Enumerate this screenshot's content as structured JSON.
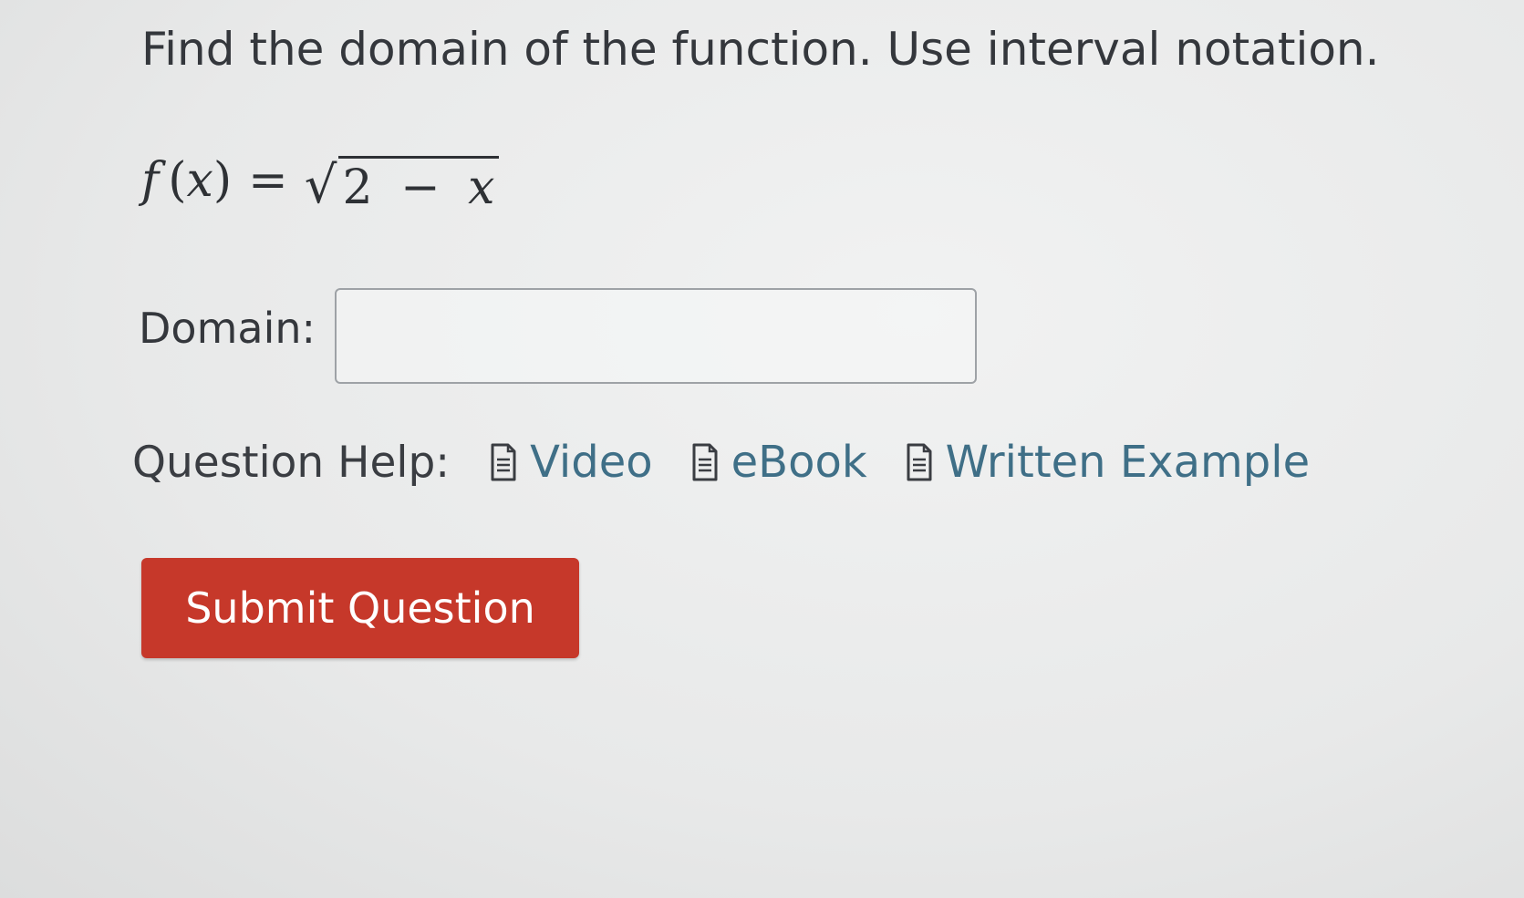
{
  "question": {
    "prompt": "Find the domain of the function. Use interval notation.",
    "formula": {
      "func": "f",
      "open_paren": "(",
      "var": "x",
      "close_paren": ")",
      "equals": "=",
      "root_sign": "√",
      "radicand_number": "2",
      "radicand_op": "−",
      "radicand_var": "x"
    }
  },
  "answer": {
    "label": "Domain:",
    "value": "",
    "placeholder": ""
  },
  "help": {
    "label": "Question Help:",
    "links": [
      {
        "label": "Video",
        "icon": "document-icon"
      },
      {
        "label": "eBook",
        "icon": "document-icon"
      },
      {
        "label": "Written Example",
        "icon": "document-icon"
      }
    ],
    "link_color": "#3f6f87"
  },
  "submit": {
    "label": "Submit Question",
    "color": "#c6382a"
  }
}
